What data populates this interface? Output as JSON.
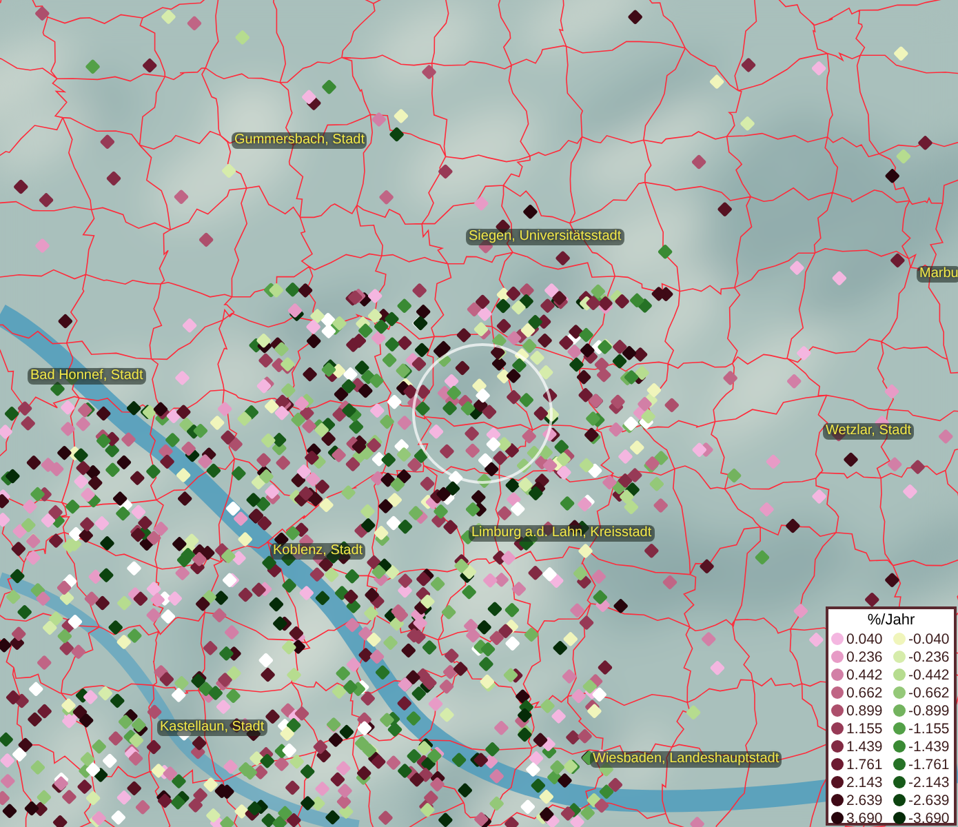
{
  "map": {
    "cities": [
      {
        "name": "Gummersbach, Stadt"
      },
      {
        "name": "Siegen, Universitätsstadt"
      },
      {
        "name": "Marbu"
      },
      {
        "name": "Bad Honnef, Stadt"
      },
      {
        "name": "Wetzlar, Stadt"
      },
      {
        "name": "Limburg a.d. Lahn, Kreisstadt"
      },
      {
        "name": "Koblenz, Stadt"
      },
      {
        "name": "Kastellaun, Stadt"
      },
      {
        "name": "Wiesbaden, Landeshauptstadt"
      }
    ]
  },
  "legend": {
    "title": "%/Jahr",
    "positive": [
      {
        "value": "0.040",
        "color": "#f4b6e0"
      },
      {
        "value": "0.236",
        "color": "#e79bc6"
      },
      {
        "value": "0.442",
        "color": "#d27fa6"
      },
      {
        "value": "0.662",
        "color": "#c06585"
      },
      {
        "value": "0.899",
        "color": "#ad4f6c"
      },
      {
        "value": "1.155",
        "color": "#973a56"
      },
      {
        "value": "1.439",
        "color": "#822a43"
      },
      {
        "value": "1.761",
        "color": "#6d1a31"
      },
      {
        "value": "2.143",
        "color": "#561222"
      },
      {
        "value": "2.639",
        "color": "#3f0a16"
      },
      {
        "value": "3.690",
        "color": "#27040c"
      }
    ],
    "negative": [
      {
        "value": "-0.040",
        "color": "#f0f5bb"
      },
      {
        "value": "-0.236",
        "color": "#d6ecab"
      },
      {
        "value": "-0.442",
        "color": "#b6dc8f"
      },
      {
        "value": "-0.662",
        "color": "#94c878"
      },
      {
        "value": "-0.899",
        "color": "#73b35e"
      },
      {
        "value": "-1.155",
        "color": "#53a047"
      },
      {
        "value": "-1.439",
        "color": "#3a8a34"
      },
      {
        "value": "-1.761",
        "color": "#267226"
      },
      {
        "value": "-2.143",
        "color": "#175a19"
      },
      {
        "value": "-2.639",
        "color": "#0c430f"
      },
      {
        "value": "-3.690",
        "color": "#052b08"
      }
    ]
  }
}
